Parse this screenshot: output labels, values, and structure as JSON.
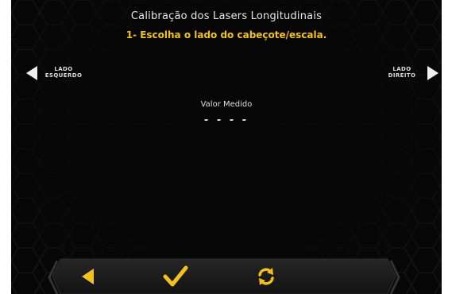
{
  "header": {
    "title": "Calibração dos Lasers Longitudinais",
    "instruction": "1- Escolha o lado do cabeçote/escala."
  },
  "left_side": {
    "line1": "LADO",
    "line2": "ESQUERDO"
  },
  "right_side": {
    "line1": "LADO",
    "line2": "DIREITO"
  },
  "measurement": {
    "label": "Valor Medido",
    "value": "- - - -"
  },
  "toolbar": {
    "back_icon": "back-arrow-icon",
    "confirm_icon": "checkmark-icon",
    "refresh_icon": "refresh-icon"
  },
  "colors": {
    "accent": "#f2c21a",
    "text": "#e6e6e6",
    "background": "#070707",
    "bar": "#1c1c1c"
  }
}
